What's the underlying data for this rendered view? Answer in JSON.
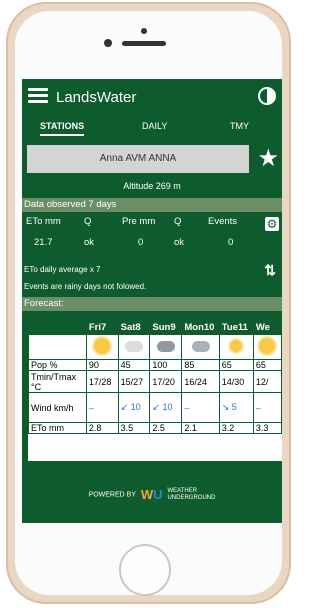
{
  "app": {
    "title": "LandsWater"
  },
  "tabs": [
    {
      "label": "STATIONS",
      "active": true
    },
    {
      "label": "DAILY",
      "active": false
    },
    {
      "label": "TMY",
      "active": false
    }
  ],
  "station": {
    "name": "Anna AVM ANNA",
    "altitude": "Altitude  269 m"
  },
  "observed": {
    "section_title": "Data observed 7 days",
    "headers": [
      "ETo mm",
      "Q",
      "Pre mm",
      "Q",
      "Events"
    ],
    "values": [
      "21.7",
      "ok",
      "0",
      "ok",
      "0"
    ],
    "note1": "ETo daily average x 7",
    "note2": "Events are rainy days not folowed."
  },
  "forecast": {
    "section_title": "Forecast:",
    "days": [
      "Fri7",
      "Sat8",
      "Sun9",
      "Mon10",
      "Tue11",
      "We"
    ],
    "weather_icons": [
      "sun-icon",
      "sun-cloud-icon",
      "cloud-rain-icon",
      "cloud-rain-icon",
      "sun-rain-icon",
      "sun-icon"
    ],
    "rows": [
      {
        "label": "Pop %",
        "values": [
          "90",
          "45",
          "100",
          "85",
          "65",
          "65"
        ]
      },
      {
        "label": "Tmin/Tmax °C",
        "values": [
          "17/28",
          "15/27",
          "17/20",
          "16/24",
          "14/30",
          "12/"
        ]
      },
      {
        "label": "Wind km/h",
        "values": [
          "–",
          "↙ 10",
          "↙ 10",
          "–",
          "↘ 5",
          "–"
        ]
      },
      {
        "label": "ETo mm",
        "values": [
          "2.8",
          "3.5",
          "2.5",
          "2.1",
          "3.2",
          "3.3"
        ]
      }
    ]
  },
  "footer": {
    "powered": "POWERED BY",
    "logo": "WU",
    "brand_line1": "WEATHER",
    "brand_line2": "UNDERGROUND"
  },
  "colors": {
    "primary": "#0e5c2e",
    "section": "#6c8e67",
    "logo_orange": "#f2a63a",
    "logo_blue": "#2a86d1"
  }
}
